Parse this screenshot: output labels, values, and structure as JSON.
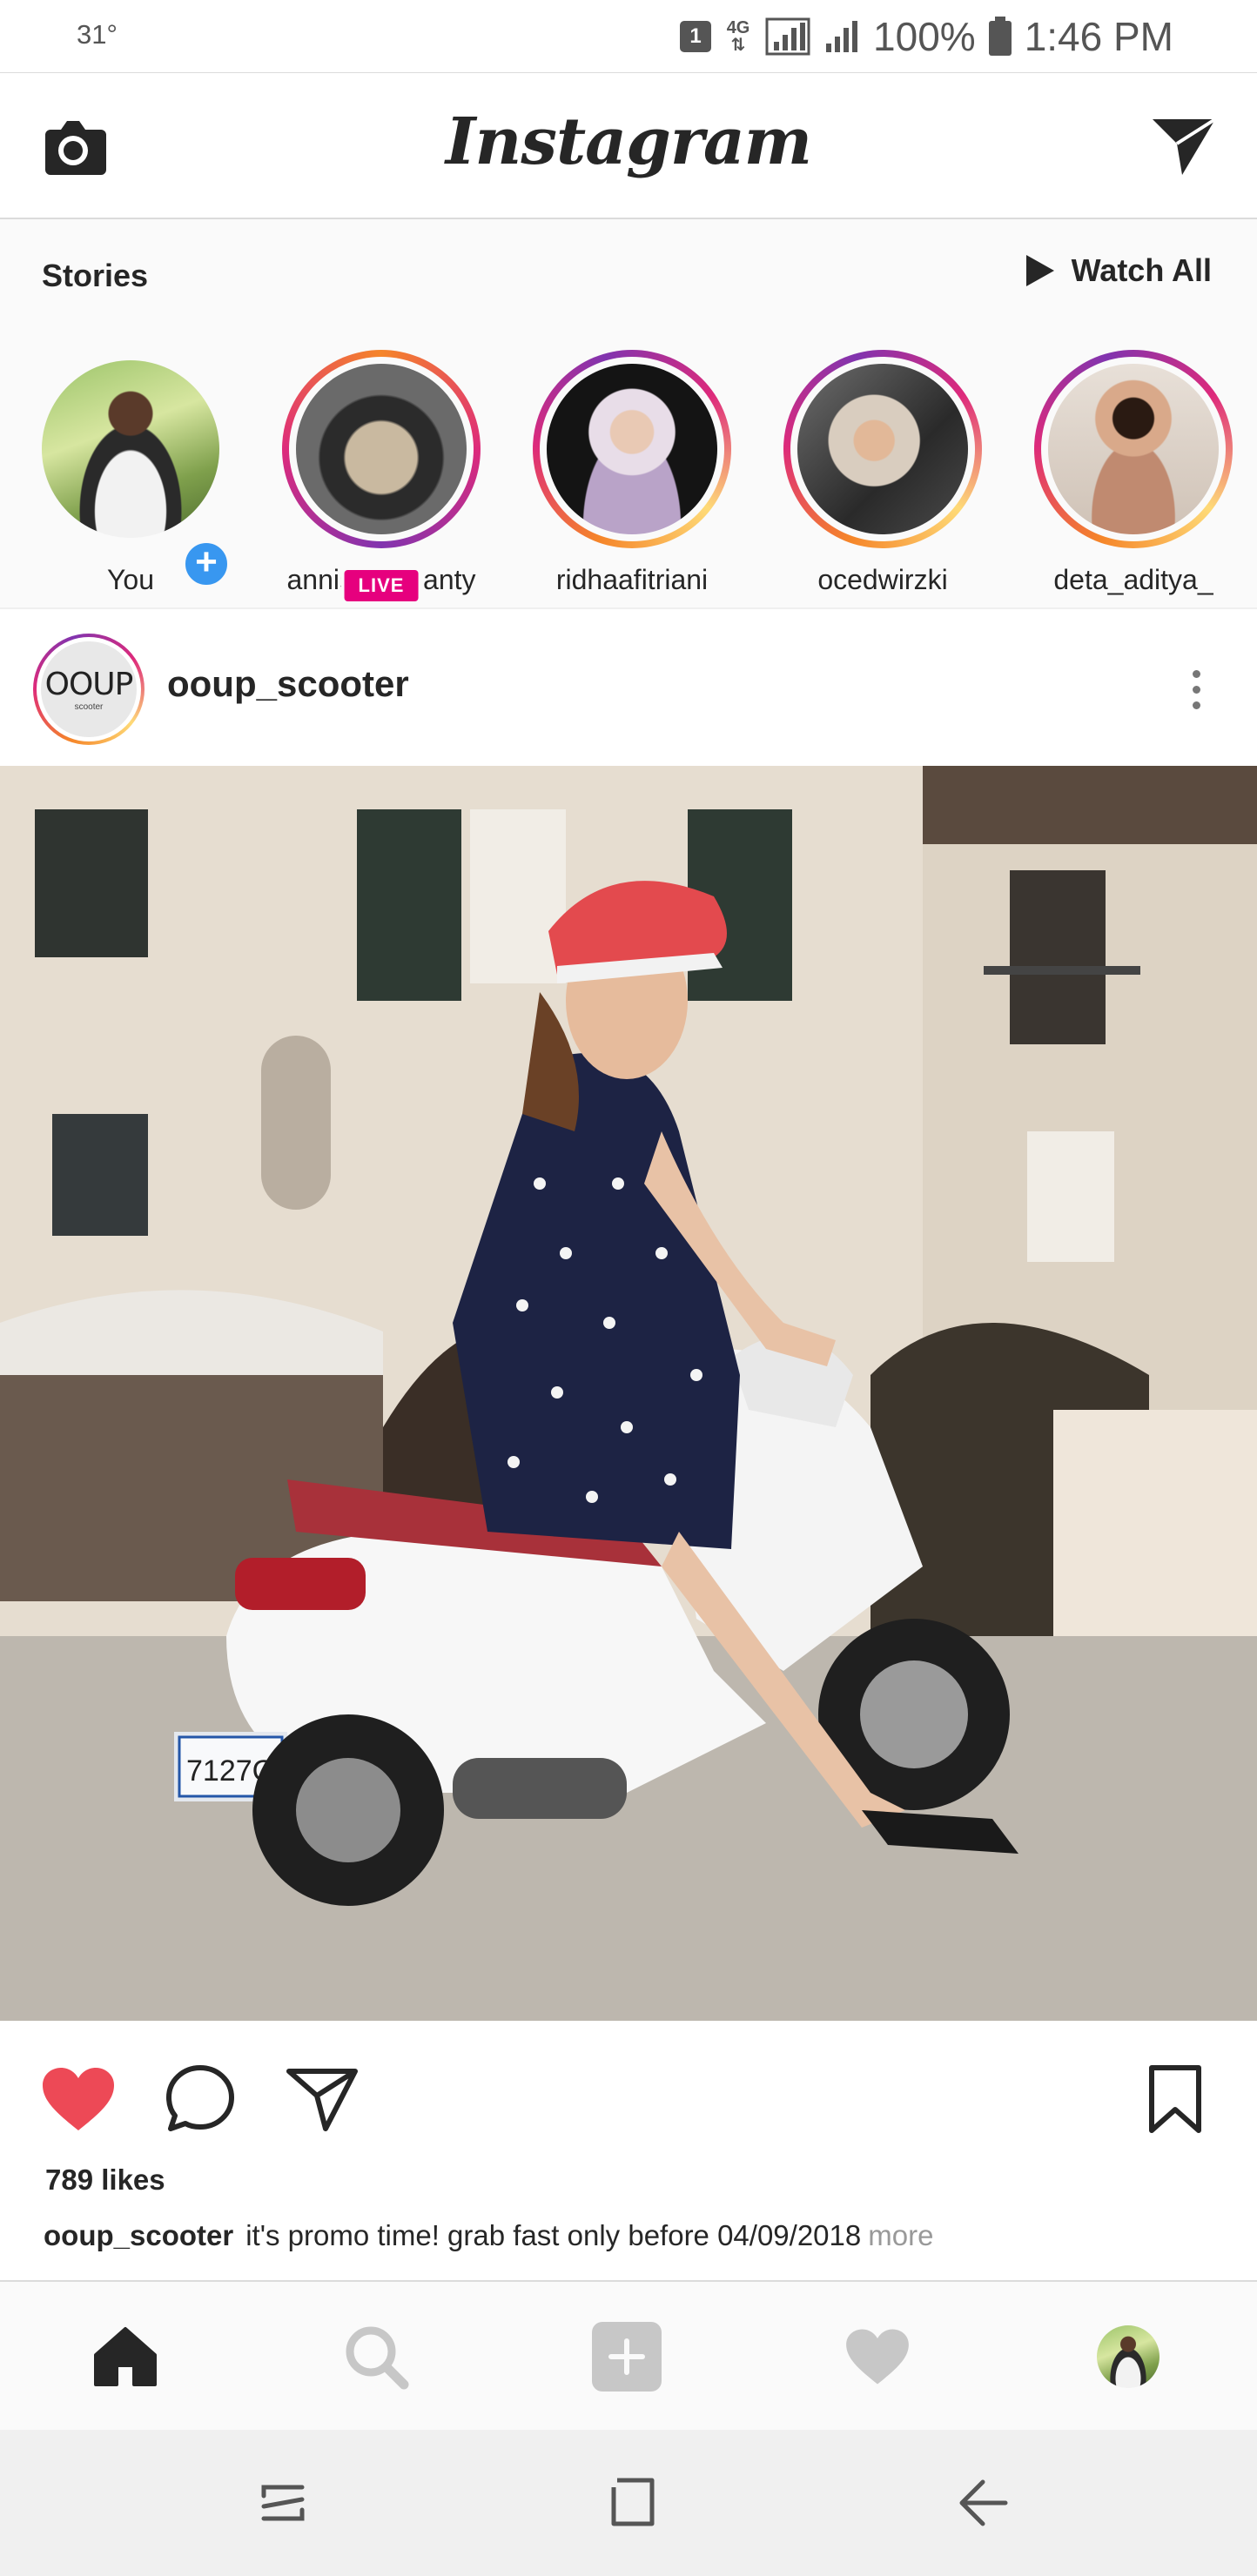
{
  "status_bar": {
    "temperature": "31°",
    "sim_slot": "1",
    "network_type": "4G",
    "battery": "100%",
    "time": "1:46 PM"
  },
  "header": {
    "logo": "Instagram",
    "left_icon": "camera-icon",
    "right_icon": "direct-message-icon"
  },
  "stories": {
    "title": "Stories",
    "watch_all_label": "Watch All",
    "items": [
      {
        "username": "You",
        "has_add_badge": true
      },
      {
        "username": "annisaprimanty",
        "live_label": "LIVE"
      },
      {
        "username": "ridhaafitriani"
      },
      {
        "username": "ocedwirzki"
      },
      {
        "username": "deta_aditya_"
      }
    ]
  },
  "post": {
    "username": "ooup_scooter",
    "avatar_text": "OOUP",
    "avatar_subtext": "scooter",
    "likes": "789 likes",
    "caption_user": "ooup_scooter",
    "caption_text": "it's promo time! grab fast only before 04/09/2018",
    "caption_more": "more",
    "liked": true,
    "plate_text": "7127G"
  },
  "bottom_nav": {
    "items": [
      "home-icon",
      "search-icon",
      "add-post-icon",
      "activity-heart-icon",
      "profile-avatar"
    ],
    "active": "home-icon"
  },
  "android_nav": {
    "items": [
      "recent-apps-icon",
      "home-square-icon",
      "back-icon"
    ]
  },
  "colors": {
    "like_red": "#ed4956",
    "link_blue": "#3897f0",
    "live_pink": "#e6007e",
    "text_dark": "#262626",
    "muted": "#999999"
  }
}
